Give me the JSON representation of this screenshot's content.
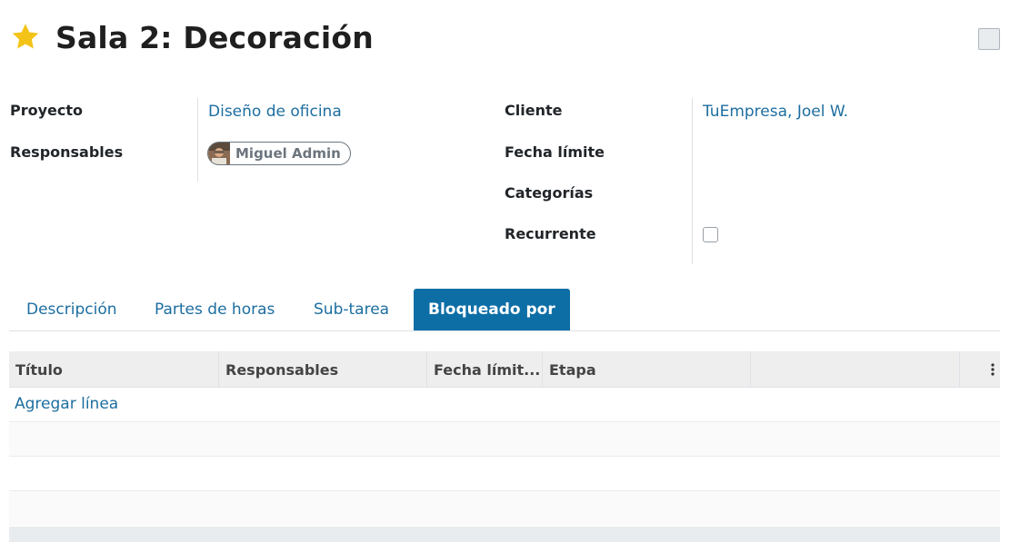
{
  "header": {
    "title": "Sala 2: Decoración",
    "favorite_icon": "star-icon",
    "favorite_color": "#f3c317"
  },
  "fields_left": {
    "project_label": "Proyecto",
    "project_value": "Diseño de oficina",
    "assignees_label": "Responsables",
    "assignee_name": "Miguel Admin"
  },
  "fields_right": {
    "client_label": "Cliente",
    "client_value": "TuEmpresa, Joel W.",
    "deadline_label": "Fecha límite",
    "tags_label": "Categorías",
    "recurrent_label": "Recurrente",
    "recurrent_checked": false
  },
  "tabs": [
    {
      "label": "Descripción",
      "active": false
    },
    {
      "label": "Partes de horas",
      "active": false
    },
    {
      "label": "Sub-tarea",
      "active": false
    },
    {
      "label": "Bloqueado por",
      "active": true
    }
  ],
  "table": {
    "columns": [
      "Título",
      "Responsables",
      "Fecha límit...",
      "Etapa",
      ""
    ],
    "add_line_label": "Agregar línea"
  },
  "colors": {
    "accent": "#0d6ea6",
    "link": "#1d6ea0"
  }
}
